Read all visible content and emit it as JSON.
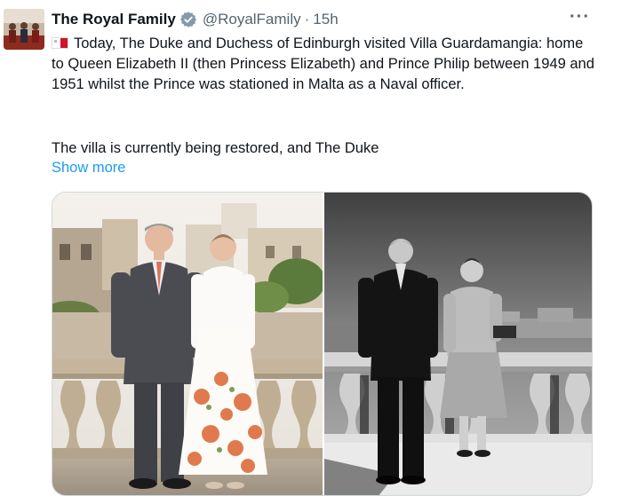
{
  "author": {
    "name": "The Royal Family",
    "handle": "@RoyalFamily",
    "separator": "·",
    "time": "15h"
  },
  "more_glyph": "···",
  "tweet": {
    "flag_icon": "malta-flag-icon",
    "paragraph1": "Today, The Duke and Duchess of Edinburgh visited Villa Guardamangia: home to Queen Elizabeth II (then Princess Elizabeth) and Prince Philip between 1949 and 1951 whilst the Prince was stationed in Malta as a Naval officer.",
    "paragraph2": "The villa is currently being restored, and The Duke",
    "show_more": "Show more"
  },
  "colors": {
    "link": "#1d9bf0",
    "verified": "#829aab",
    "muted": "#536471"
  },
  "media": [
    {
      "kind": "color-photo"
    },
    {
      "kind": "bw-photo"
    }
  ]
}
